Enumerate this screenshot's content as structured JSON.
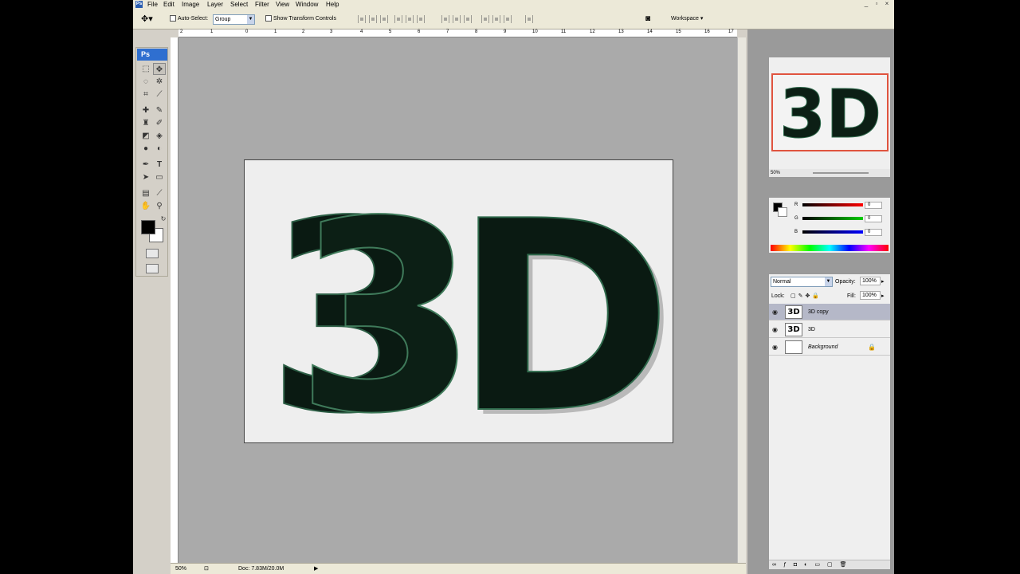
{
  "menubar": {
    "logo": "Ps",
    "items": [
      "File",
      "Edit",
      "Image",
      "Layer",
      "Select",
      "Filter",
      "View",
      "Window",
      "Help"
    ],
    "win_min": "_",
    "win_max": "▫",
    "win_close": "×"
  },
  "options": {
    "auto_select_label": "Auto-Select:",
    "auto_select_value": "Group",
    "show_transform_label": "Show Transform Controls",
    "workspace_label": "Workspace"
  },
  "toolbox": {
    "badge": "Ps"
  },
  "ruler_top_ticks": [
    "2",
    "1",
    "0",
    "1",
    "2",
    "3",
    "4",
    "5",
    "6",
    "7",
    "8",
    "9",
    "10",
    "11",
    "12",
    "13",
    "14",
    "15",
    "16",
    "17"
  ],
  "document": {
    "text": "3D"
  },
  "status": {
    "zoom": "50%",
    "doc": "Doc: 7.83M/20.0M"
  },
  "navigator": {
    "zoom": "50%",
    "thumb_text": "3D"
  },
  "color": {
    "r_label": "R",
    "g_label": "G",
    "b_label": "B",
    "r": "0",
    "g": "0",
    "b": "0"
  },
  "layers": {
    "blend": "Normal",
    "opacity_label": "Opacity:",
    "opacity": "100%",
    "lock_label": "Lock:",
    "fill_label": "Fill:",
    "fill": "100%",
    "items": [
      {
        "name": "3D copy",
        "thumb": "3D"
      },
      {
        "name": "3D",
        "thumb": "3D"
      },
      {
        "name": "Background",
        "thumb": ""
      }
    ]
  }
}
